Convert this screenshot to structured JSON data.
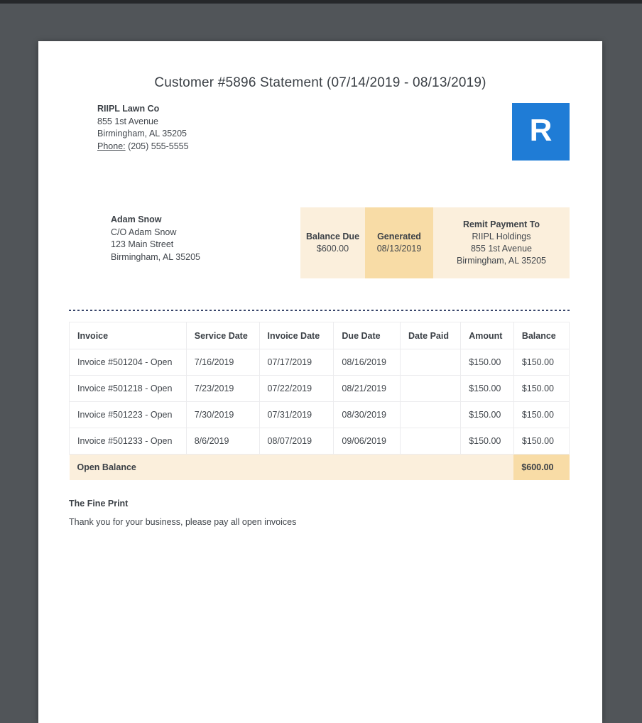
{
  "colors": {
    "brand_blue": "#1f7cd6",
    "summary_cream": "#fbefdc",
    "summary_tan": "#f8dca6",
    "backdrop_gray": "#515559",
    "divider_navy": "#39466b"
  },
  "title": "Customer #5896 Statement (07/14/2019 - 08/13/2019)",
  "company": {
    "name": "RIIPL Lawn Co",
    "address_line1": "855 1st Avenue",
    "address_line2": "Birmingham, AL 35205",
    "phone_label": "Phone:",
    "phone_number": "(205) 555-5555"
  },
  "logo": {
    "letter": "R"
  },
  "customer": {
    "name": "Adam Snow",
    "care_of": "C/O Adam Snow",
    "street": "123 Main Street",
    "city": "Birmingham, AL 35205"
  },
  "summary": {
    "balance_due": {
      "label": "Balance Due",
      "value": "$600.00"
    },
    "generated": {
      "label": "Generated",
      "value": "08/13/2019"
    },
    "remit": {
      "label": "Remit Payment To",
      "line1": "RIIPL Holdings",
      "line2": "855 1st Avenue",
      "line3": "Birmingham, AL 35205"
    }
  },
  "table": {
    "headers": [
      "Invoice",
      "Service Date",
      "Invoice Date",
      "Due Date",
      "Date Paid",
      "Amount",
      "Balance"
    ],
    "rows": [
      [
        "Invoice #501204 - Open",
        "7/16/2019",
        "07/17/2019",
        "08/16/2019",
        "",
        "$150.00",
        "$150.00"
      ],
      [
        "Invoice #501218 - Open",
        "7/23/2019",
        "07/22/2019",
        "08/21/2019",
        "",
        "$150.00",
        "$150.00"
      ],
      [
        "Invoice #501223 - Open",
        "7/30/2019",
        "07/31/2019",
        "08/30/2019",
        "",
        "$150.00",
        "$150.00"
      ],
      [
        "Invoice #501233 - Open",
        "8/6/2019",
        "08/07/2019",
        "09/06/2019",
        "",
        "$150.00",
        "$150.00"
      ]
    ],
    "open_balance": {
      "label": "Open Balance",
      "value": "$600.00"
    }
  },
  "fine_print": {
    "heading": "The Fine Print",
    "text": "Thank you for your business, please pay all open invoices"
  }
}
